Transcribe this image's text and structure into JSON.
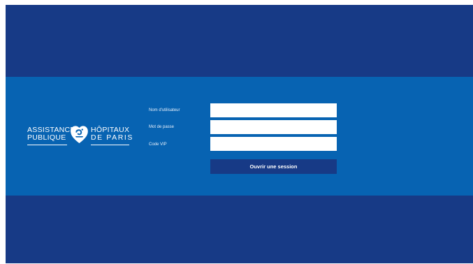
{
  "brand": {
    "line_left_1": "ASSISTANCE",
    "line_left_2": "PUBLIQUE",
    "line_right_1": "HÔPITAUX",
    "line_right_2": "DE PARIS",
    "logo_icon": "heart-emblem-icon"
  },
  "login": {
    "username_label": "Nom d'utilisateur",
    "username_value": "",
    "password_label": "Mot de passe",
    "password_value": "",
    "vip_label": "Code VIP",
    "vip_value": "",
    "submit_label": "Ouvrir une session"
  },
  "colors": {
    "background": "#173a86",
    "band": "#0763b2",
    "field": "#ffffff",
    "button": "#173a86"
  }
}
